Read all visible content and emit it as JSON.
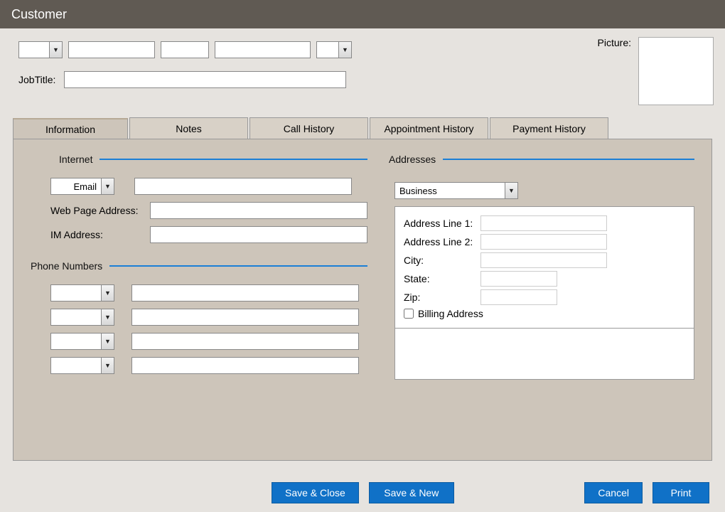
{
  "title": "Customer",
  "jobTitleLabel": "JobTitle:",
  "pictureLabel": "Picture:",
  "fields": {
    "prefix": "",
    "firstName": "",
    "middleName": "",
    "lastName": "",
    "suffix": "",
    "jobTitle": ""
  },
  "tabs": [
    {
      "label": "Information",
      "active": true
    },
    {
      "label": "Notes"
    },
    {
      "label": "Call History"
    },
    {
      "label": "Appointment History"
    },
    {
      "label": "Payment History"
    }
  ],
  "sections": {
    "internet": {
      "title": "Internet",
      "emailTypeLabel": "Email",
      "emailValue": "",
      "webLabel": "Web Page Address:",
      "webValue": "",
      "imLabel": "IM Address:",
      "imValue": ""
    },
    "phones": {
      "title": "Phone Numbers",
      "rows": [
        {
          "type": "",
          "number": ""
        },
        {
          "type": "",
          "number": ""
        },
        {
          "type": "",
          "number": ""
        },
        {
          "type": "",
          "number": ""
        }
      ]
    },
    "addresses": {
      "title": "Addresses",
      "typeValue": "Business",
      "line1Label": "Address Line 1:",
      "line1Value": "",
      "line2Label": "Address Line 2:",
      "line2Value": "",
      "cityLabel": "City:",
      "cityValue": "",
      "stateLabel": "State:",
      "stateValue": "",
      "zipLabel": "Zip:",
      "zipValue": "",
      "billingLabel": "Billing Address",
      "billingChecked": false
    }
  },
  "buttons": {
    "saveClose": "Save & Close",
    "saveNew": "Save & New",
    "cancel": "Cancel",
    "print": "Print"
  }
}
